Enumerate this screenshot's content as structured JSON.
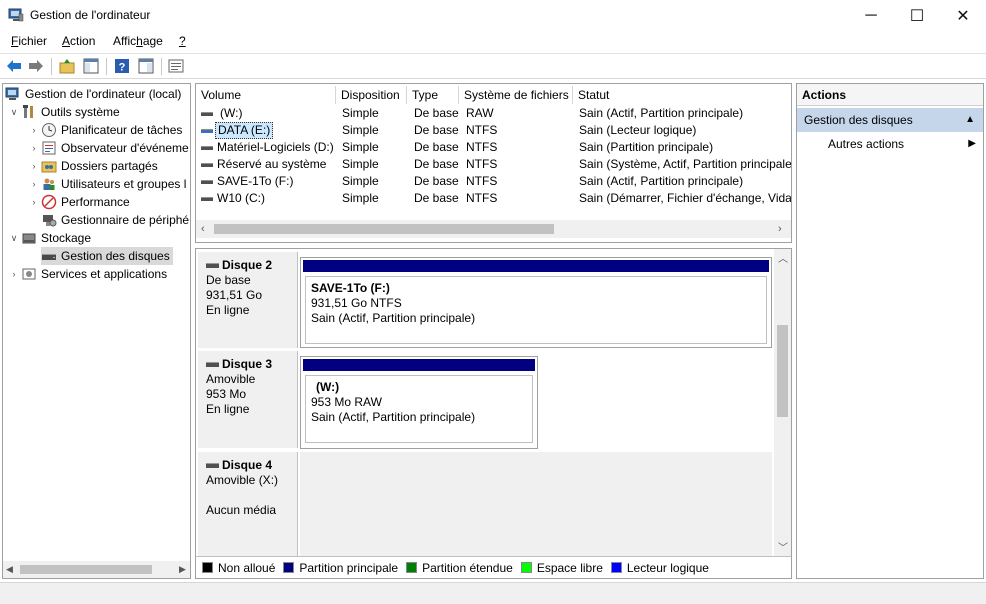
{
  "window": {
    "title": "Gestion de l'ordinateur",
    "controls": {
      "minimize": "─",
      "maximize": "☐",
      "close": "✕"
    }
  },
  "menu": [
    {
      "label": "Fichier",
      "accel": "F",
      "rest": "ichier"
    },
    {
      "label": "Action",
      "accel": "A",
      "rest": "ction"
    },
    {
      "label": "Affichage",
      "pre": "Affic",
      "accel": "h",
      "post": "age"
    },
    {
      "label": "?",
      "accel": "?"
    }
  ],
  "toolbar": {
    "icons": [
      "back-arrow-icon",
      "forward-arrow-icon",
      "up-folder-icon",
      "show-hide-tree-icon",
      "help-icon",
      "action-pane-icon",
      "properties-icon"
    ]
  },
  "tree": {
    "items": [
      {
        "label": "Gestion de l'ordinateur (local)",
        "icon": "computer-management-icon",
        "expander": "",
        "level": 0
      },
      {
        "label": "Outils système",
        "icon": "tools-icon",
        "expander": "expanded",
        "level": 1
      },
      {
        "label": "Planificateur de tâches",
        "icon": "clock-icon",
        "expander": "collapsed",
        "level": 2
      },
      {
        "label": "Observateur d'événeme",
        "icon": "event-viewer-icon",
        "expander": "collapsed",
        "level": 2
      },
      {
        "label": "Dossiers partagés",
        "icon": "shared-folder-icon",
        "expander": "collapsed",
        "level": 2
      },
      {
        "label": "Utilisateurs et groupes l",
        "icon": "users-icon",
        "expander": "collapsed",
        "level": 2
      },
      {
        "label": "Performance",
        "icon": "performance-icon",
        "expander": "collapsed",
        "level": 2
      },
      {
        "label": "Gestionnaire de périphé",
        "icon": "device-manager-icon",
        "expander": "",
        "level": 2
      },
      {
        "label": "Stockage",
        "icon": "storage-icon",
        "expander": "expanded",
        "level": 1
      },
      {
        "label": "Gestion des disques",
        "icon": "disk-management-icon",
        "expander": "",
        "level": 2,
        "selected": true
      },
      {
        "label": "Services et applications",
        "icon": "services-icon",
        "expander": "collapsed",
        "level": 1
      }
    ]
  },
  "volumes": {
    "columns": [
      "Volume",
      "Disposition",
      "Type",
      "Système de fichiers",
      "Statut"
    ],
    "rows": [
      {
        "volume": "(W:)",
        "disposition": "Simple",
        "type": "De base",
        "fs": "RAW",
        "status": "Sain (Actif, Partition principale)"
      },
      {
        "volume": "DATA (E:)",
        "disposition": "Simple",
        "type": "De base",
        "fs": "NTFS",
        "status": "Sain (Lecteur logique)",
        "selected": true
      },
      {
        "volume": "Matériel-Logiciels (D:)",
        "disposition": "Simple",
        "type": "De base",
        "fs": "NTFS",
        "status": "Sain (Partition principale)"
      },
      {
        "volume": "Réservé au système",
        "disposition": "Simple",
        "type": "De base",
        "fs": "NTFS",
        "status": "Sain (Système, Actif, Partition principale"
      },
      {
        "volume": "SAVE-1To (F:)",
        "disposition": "Simple",
        "type": "De base",
        "fs": "NTFS",
        "status": "Sain (Actif, Partition principale)"
      },
      {
        "volume": "W10 (C:)",
        "disposition": "Simple",
        "type": "De base",
        "fs": "NTFS",
        "status": "Sain (Démarrer, Fichier d'échange, Vidag"
      }
    ]
  },
  "disks": [
    {
      "name": "Disque 2",
      "kind": "De base",
      "size": "931,51 Go",
      "state": "En ligne",
      "partition": {
        "name": "SAVE-1To  (F:)",
        "size": "931,51 Go NTFS",
        "status": "Sain (Actif, Partition principale)"
      }
    },
    {
      "name": "Disque 3",
      "kind": "Amovible",
      "size": "953 Mo",
      "state": "En ligne",
      "partition": {
        "name": "(W:)",
        "size": "953 Mo RAW",
        "status": "Sain (Actif, Partition principale)"
      }
    },
    {
      "name": "Disque 4",
      "kind": "Amovible (X:)",
      "size": "",
      "state": "Aucun média"
    }
  ],
  "legend": [
    {
      "label": "Non alloué",
      "color": "#000000"
    },
    {
      "label": "Partition principale",
      "color": "#000080"
    },
    {
      "label": "Partition étendue",
      "color": "#008000"
    },
    {
      "label": "Espace libre",
      "color": "#00ff00"
    },
    {
      "label": "Lecteur logique",
      "color": "#0000ff"
    }
  ],
  "actions": {
    "title": "Actions",
    "group": "Gestion des disques",
    "more": "Autres actions"
  },
  "colors": {
    "selection": "#cce8ff",
    "partition_primary": "#000080",
    "actions_group": "#c5d5ea"
  }
}
